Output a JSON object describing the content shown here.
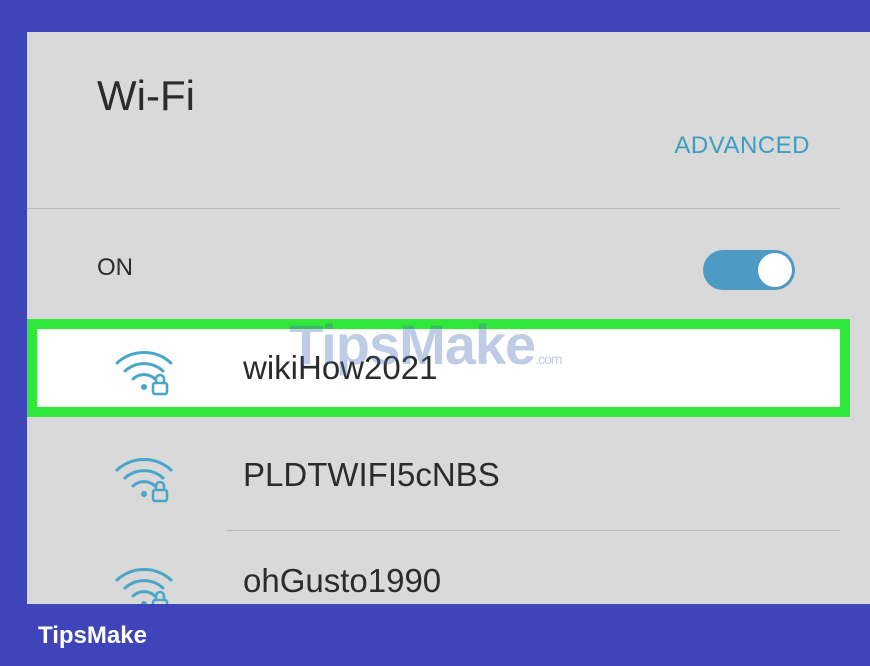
{
  "header": {
    "title": "Wi-Fi",
    "advanced_label": "ADVANCED"
  },
  "wifi_toggle": {
    "label": "ON",
    "state": "on",
    "color": "#4d9bc4"
  },
  "networks": [
    {
      "name": "wikiHow2021",
      "secured": true,
      "selected": true,
      "icon": "wifi-lock-icon"
    },
    {
      "name": "PLDTWIFI5cNBS",
      "secured": true,
      "selected": false,
      "icon": "wifi-lock-icon"
    },
    {
      "name": "ohGusto1990",
      "secured": true,
      "selected": false,
      "icon": "wifi-lock-icon"
    }
  ],
  "watermark": {
    "text": "TipsMake",
    "suffix": ".com"
  },
  "footer": {
    "brand": "TipsMake"
  },
  "colors": {
    "frame": "#3f44b8",
    "highlight": "#2fe83a",
    "accent": "#3a9fbf"
  }
}
